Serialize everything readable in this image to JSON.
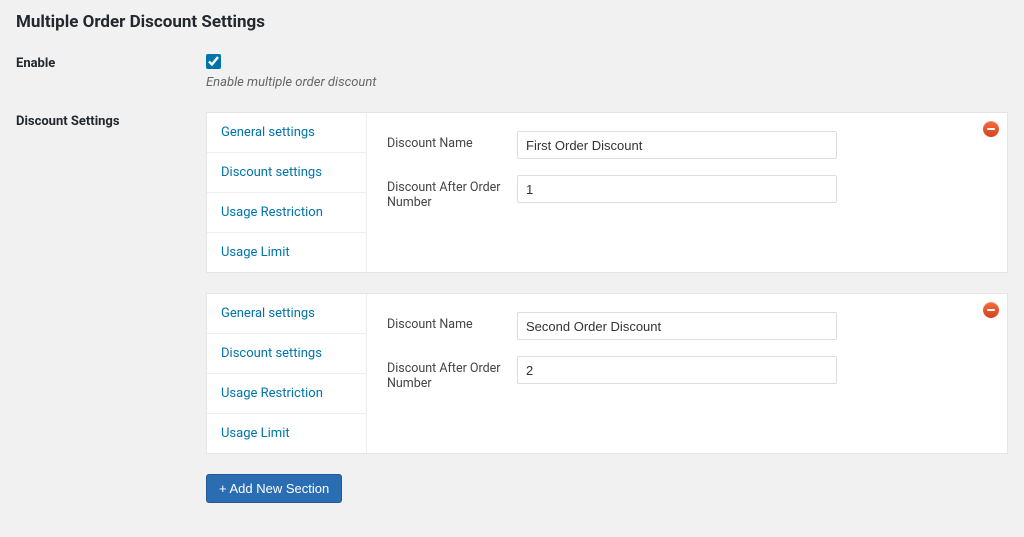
{
  "page_title": "Multiple Order Discount Settings",
  "enable": {
    "label": "Enable",
    "checked": true,
    "helper": "Enable multiple order discount"
  },
  "discount_settings_label": "Discount Settings",
  "tabs": [
    "General settings",
    "Discount settings",
    "Usage Restriction",
    "Usage Limit"
  ],
  "field_labels": {
    "discount_name": "Discount Name",
    "discount_after_order_number": "Discount After Order Number"
  },
  "sections": [
    {
      "discount_name": "First Order Discount",
      "discount_after_order_number": "1"
    },
    {
      "discount_name": "Second Order Discount",
      "discount_after_order_number": "2"
    }
  ],
  "add_button_label": "+ Add New Section"
}
